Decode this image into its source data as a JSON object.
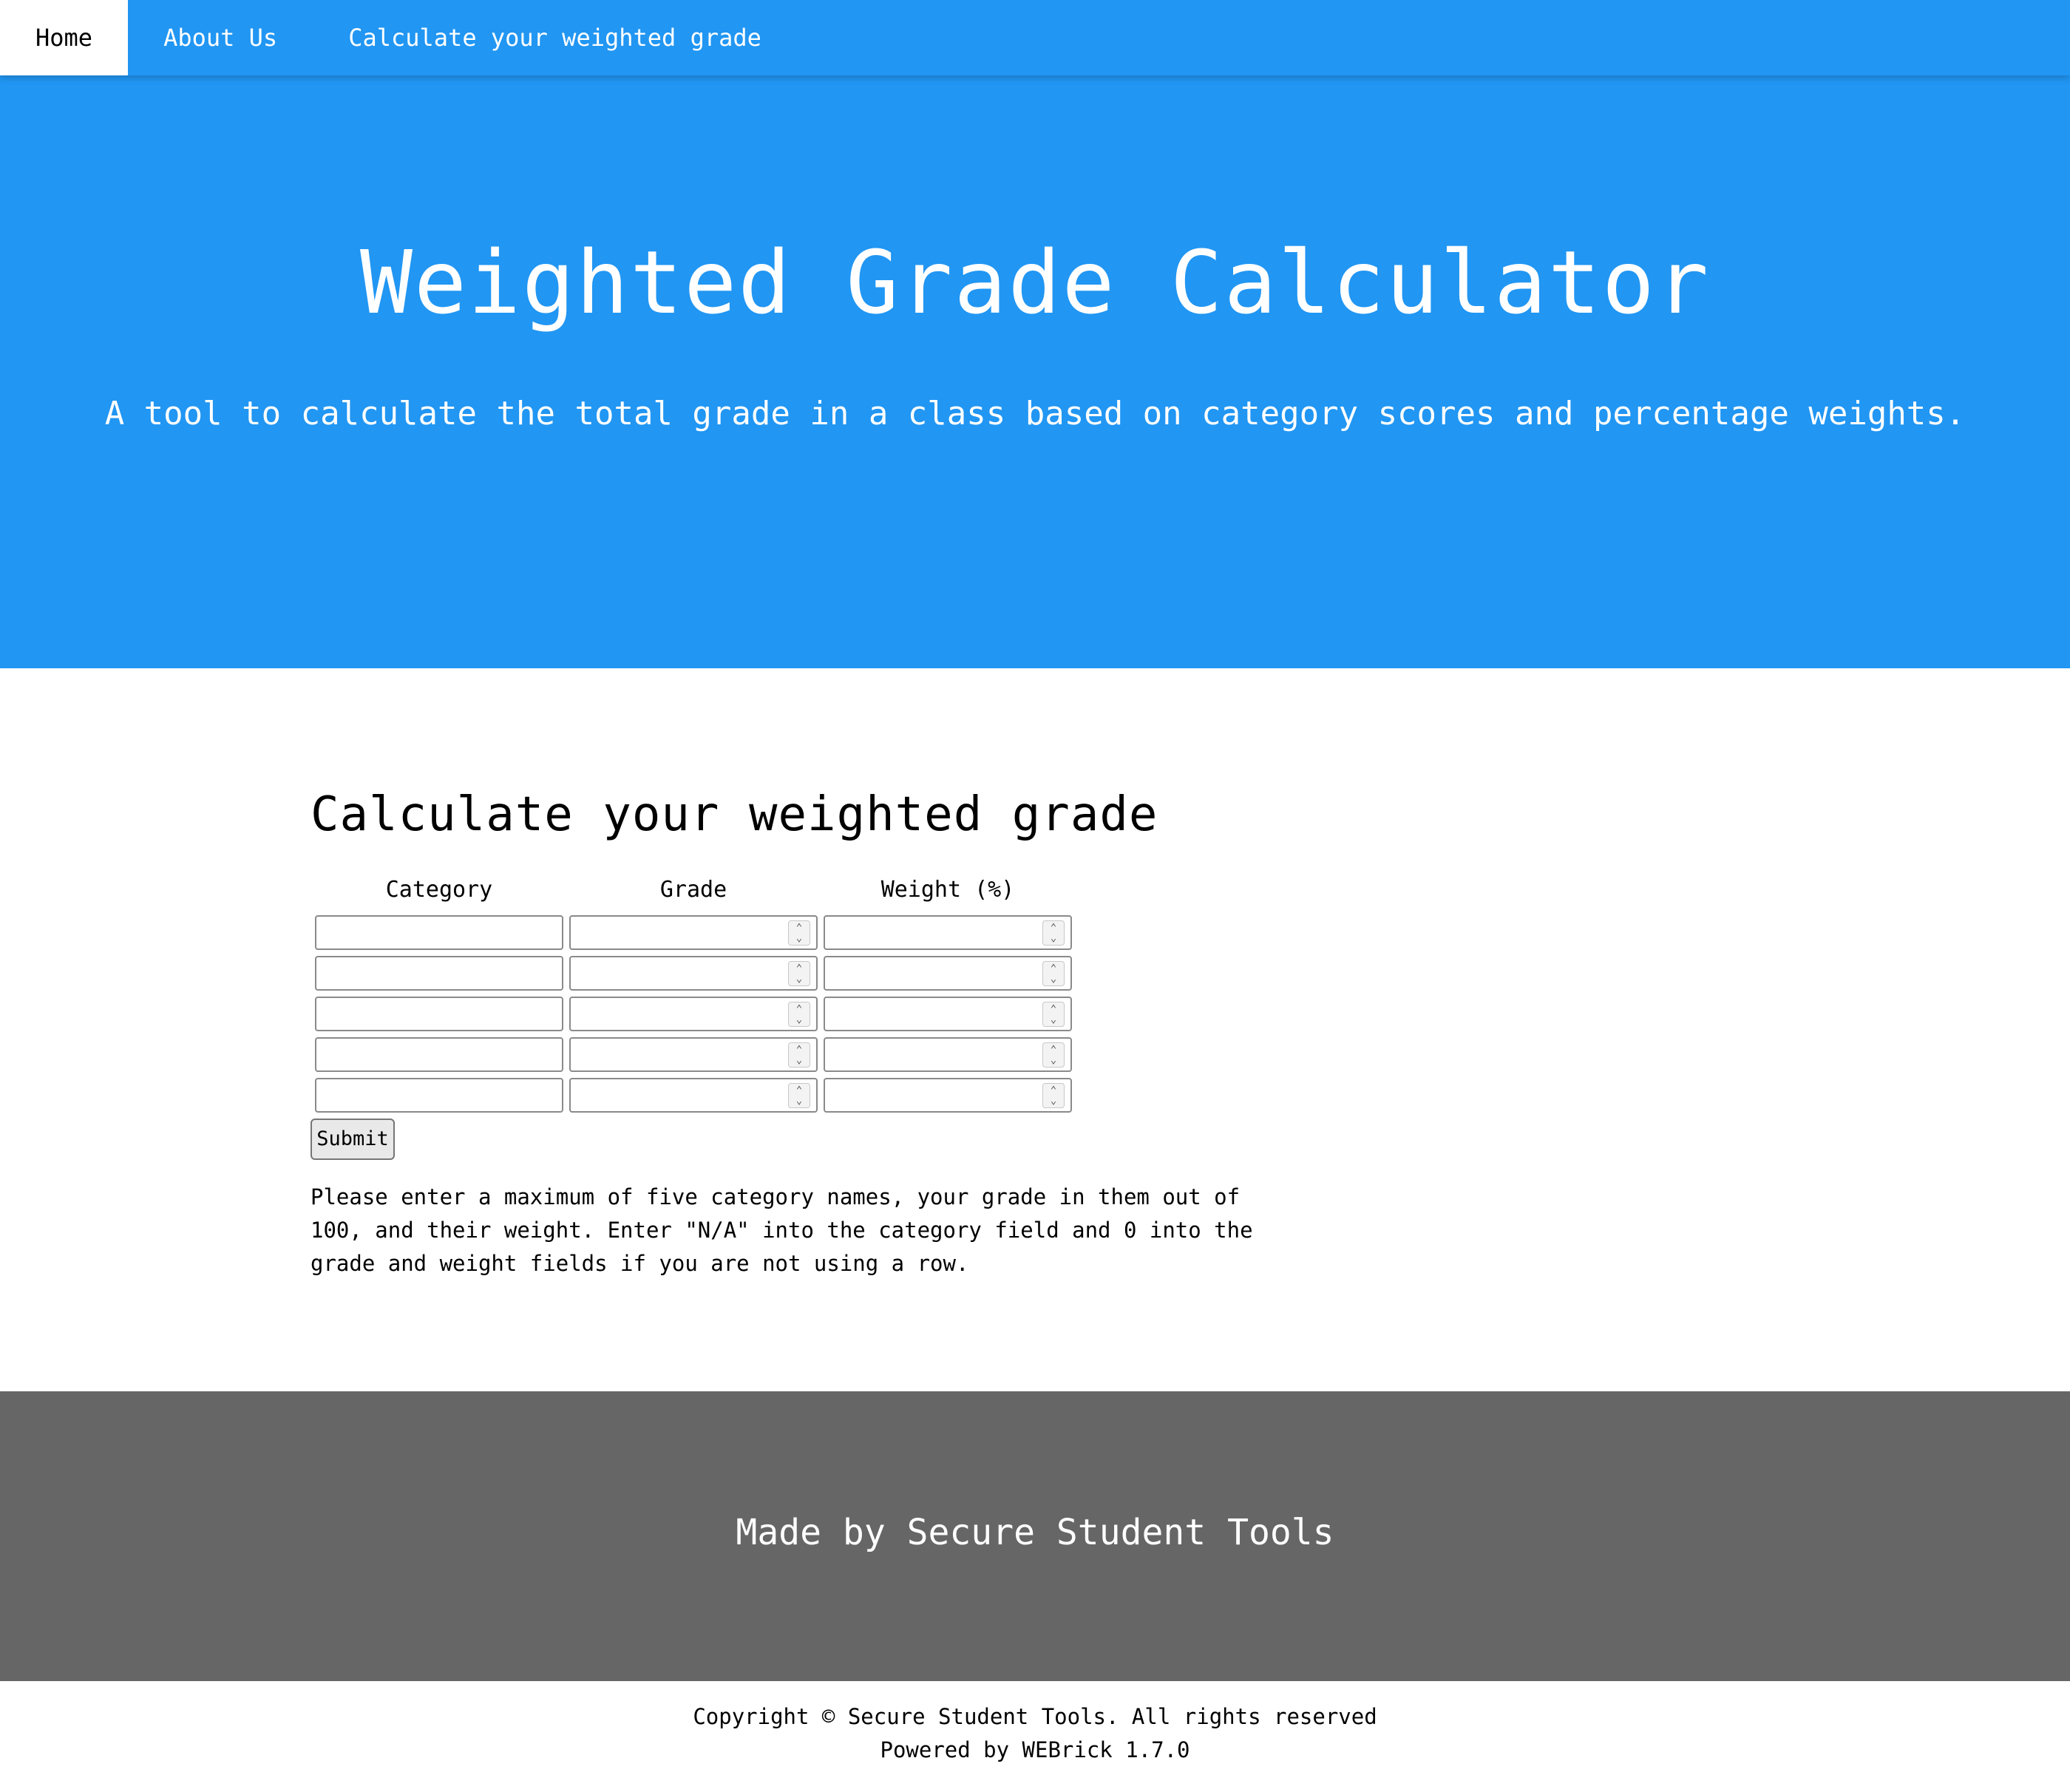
{
  "nav": {
    "items": [
      {
        "label": "Home",
        "active": true
      },
      {
        "label": "About Us",
        "active": false
      },
      {
        "label": "Calculate your weighted grade",
        "active": false
      }
    ]
  },
  "hero": {
    "title": "Weighted Grade Calculator",
    "subtitle": "A tool to calculate the total grade in a class based on category scores and percentage weights."
  },
  "main": {
    "title": "Calculate your weighted grade",
    "columns": [
      "Category",
      "Grade",
      "Weight (%)"
    ],
    "rows": [
      {
        "category": "",
        "grade": "",
        "weight": ""
      },
      {
        "category": "",
        "grade": "",
        "weight": ""
      },
      {
        "category": "",
        "grade": "",
        "weight": ""
      },
      {
        "category": "",
        "grade": "",
        "weight": ""
      },
      {
        "category": "",
        "grade": "",
        "weight": ""
      }
    ],
    "submit_label": "Submit",
    "instructions": "Please enter a maximum of five category names, your grade in them out of 100, and their weight. Enter \"N/A\" into the category field and 0 into the grade and weight fields if you are not using a row."
  },
  "footer": {
    "text": "Made by Secure Student Tools",
    "copyright": "Copyright © Secure Student Tools. All rights reserved",
    "powered_by": "Powered by WEBrick 1.7.0"
  },
  "colors": {
    "primary": "#2196f3",
    "footer_bg": "#666666",
    "text": "#000000",
    "inverse_text": "#ffffff"
  }
}
